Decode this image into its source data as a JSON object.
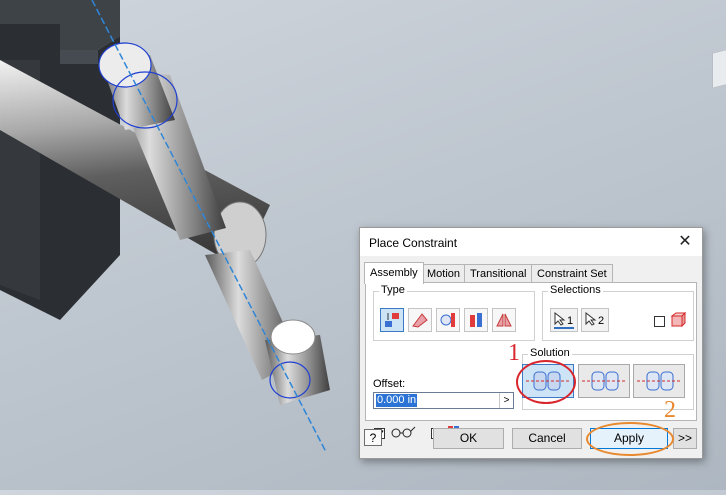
{
  "dialog": {
    "title": "Place Constraint",
    "close_icon": "close-icon",
    "tabs": [
      {
        "label": "Assembly",
        "active": true
      },
      {
        "label": "Motion",
        "active": false
      },
      {
        "label": "Transitional",
        "active": false
      },
      {
        "label": "Constraint Set",
        "active": false
      }
    ],
    "type_group_label": "Type",
    "type_buttons": [
      {
        "icon": "mate-constraint-icon",
        "selected": true
      },
      {
        "icon": "angle-constraint-icon",
        "selected": false
      },
      {
        "icon": "tangent-constraint-icon",
        "selected": false
      },
      {
        "icon": "insert-constraint-icon",
        "selected": false
      },
      {
        "icon": "symmetry-constraint-icon",
        "selected": false
      }
    ],
    "selections_group_label": "Selections",
    "selection_buttons": [
      {
        "label": "1",
        "icon": "select-arrow-icon"
      },
      {
        "label": "2",
        "icon": "select-arrow-icon"
      }
    ],
    "pick_part_first_checked": false,
    "offset_label": "Offset:",
    "offset_value": "0.000 in",
    "solution_group_label": "Solution",
    "solution_buttons": [
      {
        "icon": "mate-solution-icon",
        "selected": true
      },
      {
        "icon": "flush-solution-icon",
        "selected": false
      },
      {
        "icon": "undirected-solution-icon",
        "selected": false
      }
    ],
    "show_preview_checked": true,
    "predict_offset_checked": false,
    "buttons": {
      "ok": "OK",
      "cancel": "Cancel",
      "apply": "Apply",
      "more": ">>"
    }
  },
  "annotations": [
    {
      "label": "1",
      "color": "#d8262d"
    },
    {
      "label": "2",
      "color": "#e8892f"
    }
  ],
  "colors": {
    "axis_line": "#2f86d6",
    "selection_highlight": "#1f3fd1",
    "accent": "#0078d7"
  }
}
